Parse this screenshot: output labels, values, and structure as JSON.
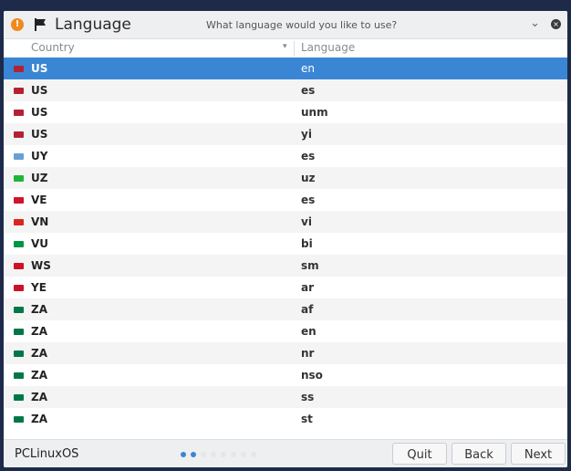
{
  "titlebar": {
    "title": "Language",
    "prompt": "What language would you like to use?",
    "close_icon_label": "×"
  },
  "table": {
    "col_country": "Country",
    "col_language": "Language",
    "rows": [
      {
        "flag_color": "#b22234",
        "country": "US",
        "language": "en",
        "selected": true
      },
      {
        "flag_color": "#b22234",
        "country": "US",
        "language": "es"
      },
      {
        "flag_color": "#b22234",
        "country": "US",
        "language": "unm"
      },
      {
        "flag_color": "#b22234",
        "country": "US",
        "language": "yi"
      },
      {
        "flag_color": "#6a9fd4",
        "country": "UY",
        "language": "es"
      },
      {
        "flag_color": "#1eb53a",
        "country": "UZ",
        "language": "uz"
      },
      {
        "flag_color": "#cf142b",
        "country": "VE",
        "language": "es"
      },
      {
        "flag_color": "#da251d",
        "country": "VN",
        "language": "vi"
      },
      {
        "flag_color": "#009543",
        "country": "VU",
        "language": "bi"
      },
      {
        "flag_color": "#ce1126",
        "country": "WS",
        "language": "sm"
      },
      {
        "flag_color": "#ce1126",
        "country": "YE",
        "language": "ar"
      },
      {
        "flag_color": "#007749",
        "country": "ZA",
        "language": "af"
      },
      {
        "flag_color": "#007749",
        "country": "ZA",
        "language": "en"
      },
      {
        "flag_color": "#007749",
        "country": "ZA",
        "language": "nr"
      },
      {
        "flag_color": "#007749",
        "country": "ZA",
        "language": "nso"
      },
      {
        "flag_color": "#007749",
        "country": "ZA",
        "language": "ss"
      },
      {
        "flag_color": "#007749",
        "country": "ZA",
        "language": "st"
      }
    ]
  },
  "footer": {
    "brand": "PCLinuxOS",
    "steps_total": 8,
    "steps_active": 2,
    "quit_label": "Quit",
    "back_label": "Back",
    "next_label": "Next"
  },
  "colors": {
    "accent": "#3a86d4",
    "title_icon": "#f08a1c"
  }
}
